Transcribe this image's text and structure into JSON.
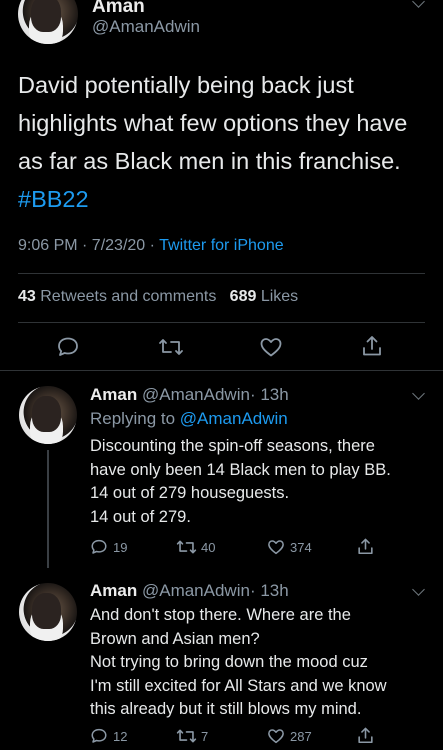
{
  "main_tweet": {
    "author_name": "Aman",
    "author_handle": "@AmanAdwin",
    "text": "David potentially being back just highlights what few options they have as far as Black men in this franchise. ",
    "hashtag": "#BB22",
    "time": "9:06 PM · 7/23/20 · ",
    "source": "Twitter for iPhone",
    "retweets_count": "43",
    "retweets_label": "Retweets and comments",
    "likes_count": "689",
    "likes_label": "Likes"
  },
  "replies": [
    {
      "author_name": "Aman",
      "author_handle": "@AmanAdwin",
      "time_ago": "· 13h",
      "replying_to_label": "Replying to ",
      "replying_to_handle": "@AmanAdwin",
      "lines": [
        "Discounting the spin-off seasons, there",
        "have only been 14 Black men to play BB.",
        "14 out of 279 houseguests.",
        "14 out of 279."
      ],
      "reply_count": "19",
      "retweet_count": "40",
      "like_count": "374"
    },
    {
      "author_name": "Aman",
      "author_handle": "@AmanAdwin",
      "time_ago": "· 13h",
      "lines": [
        "And don't stop there. Where are the",
        "Brown and Asian men?",
        "Not trying to bring down the mood cuz",
        "I'm still excited for All Stars and we know",
        "this already but it still blows my mind."
      ],
      "reply_count": "12",
      "retweet_count": "7",
      "like_count": "287"
    }
  ],
  "colors": {
    "background": "#000000",
    "text": "#e7e9ea",
    "muted": "#8b98a5",
    "accent": "#1d9bf0"
  },
  "icons": [
    "reply-icon",
    "retweet-icon",
    "like-icon",
    "share-icon",
    "chevron-down-icon"
  ]
}
